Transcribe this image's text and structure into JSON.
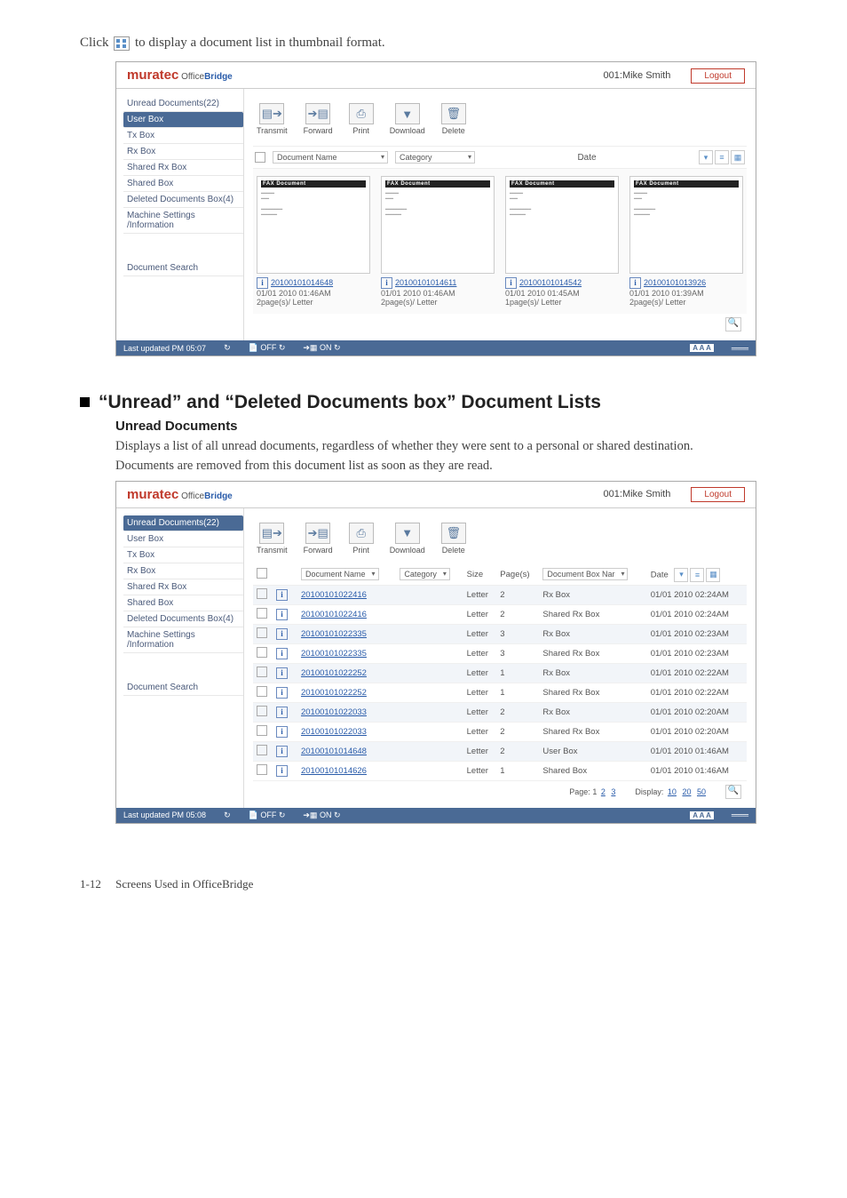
{
  "intro": {
    "prefix": "Click ",
    "suffix": " to display a document list in thumbnail format."
  },
  "brand": {
    "name": "muratec",
    "sub1": "Office",
    "sub2": "Bridge"
  },
  "user": "001:Mike Smith",
  "logout": "Logout",
  "sidebar1": {
    "items": [
      "Unread Documents(22)",
      "User Box",
      "Tx Box",
      "Rx Box",
      "Shared Rx Box",
      "Shared Box",
      "Deleted Documents Box(4)",
      "Machine Settings /Information"
    ],
    "bottom": "Document Search",
    "selected": 1
  },
  "toolbar": {
    "items": [
      {
        "label": "Transmit",
        "glyph": "▤➔"
      },
      {
        "label": "Forward",
        "glyph": "➔▤"
      },
      {
        "label": "Print",
        "glyph": "⎙"
      },
      {
        "label": "Download",
        "glyph": "▼"
      },
      {
        "label": "Delete",
        "glyph": "🗑"
      }
    ]
  },
  "filterBar1": {
    "docName": "Document Name",
    "category": "Category",
    "date": "Date"
  },
  "thumbs": [
    {
      "id": "20100101014648",
      "date": "01/01 2010 01:46AM",
      "pages": "2page(s)/ Letter"
    },
    {
      "id": "20100101014611",
      "date": "01/01 2010 01:46AM",
      "pages": "2page(s)/ Letter"
    },
    {
      "id": "20100101014542",
      "date": "01/01 2010 01:45AM",
      "pages": "1page(s)/ Letter"
    },
    {
      "id": "20100101013926",
      "date": "01/01 2010 01:39AM",
      "pages": "2page(s)/ Letter"
    }
  ],
  "faxHeader": "FAX Document",
  "footer": {
    "updated": "Last updated PM 05:07",
    "updated2": "Last updated PM 05:08",
    "off": "OFF",
    "on": "ON",
    "aaa": "A A A"
  },
  "heading": "“Unread” and “Deleted Documents box” Document Lists",
  "subheading": "Unread Documents",
  "para1": "Displays a list of all unread documents, regardless of whether they were sent to a personal or shared destination.",
  "para2": "Documents are removed from this document list as soon as they are read.",
  "sidebar2": {
    "items": [
      "Unread Documents(22)",
      "User Box",
      "Tx Box",
      "Rx Box",
      "Shared Rx Box",
      "Shared Box",
      "Deleted Documents Box(4)",
      "Machine Settings /Information"
    ],
    "bottom": "Document Search",
    "selected": 0
  },
  "tableHeaders": {
    "docName": "Document Name",
    "category": "Category",
    "size": "Size",
    "pages": "Page(s)",
    "box": "Document Box Nar",
    "date": "Date"
  },
  "rows": [
    {
      "id": "20100101022416",
      "size": "Letter",
      "pages": "2",
      "box": "Rx Box",
      "date": "01/01 2010 02:24AM"
    },
    {
      "id": "20100101022416",
      "size": "Letter",
      "pages": "2",
      "box": "Shared Rx Box",
      "date": "01/01 2010 02:24AM"
    },
    {
      "id": "20100101022335",
      "size": "Letter",
      "pages": "3",
      "box": "Rx Box",
      "date": "01/01 2010 02:23AM"
    },
    {
      "id": "20100101022335",
      "size": "Letter",
      "pages": "3",
      "box": "Shared Rx Box",
      "date": "01/01 2010 02:23AM"
    },
    {
      "id": "20100101022252",
      "size": "Letter",
      "pages": "1",
      "box": "Rx Box",
      "date": "01/01 2010 02:22AM"
    },
    {
      "id": "20100101022252",
      "size": "Letter",
      "pages": "1",
      "box": "Shared Rx Box",
      "date": "01/01 2010 02:22AM"
    },
    {
      "id": "20100101022033",
      "size": "Letter",
      "pages": "2",
      "box": "Rx Box",
      "date": "01/01 2010 02:20AM"
    },
    {
      "id": "20100101022033",
      "size": "Letter",
      "pages": "2",
      "box": "Shared Rx Box",
      "date": "01/01 2010 02:20AM"
    },
    {
      "id": "20100101014648",
      "size": "Letter",
      "pages": "2",
      "box": "User Box",
      "date": "01/01 2010 01:46AM"
    },
    {
      "id": "20100101014626",
      "size": "Letter",
      "pages": "1",
      "box": "Shared Box",
      "date": "01/01 2010 01:46AM"
    }
  ],
  "pager": {
    "pageLabel": "Page:",
    "pages": [
      "1",
      "2",
      "3"
    ],
    "displayLabel": "Display:",
    "displayOpts": [
      "10",
      "20",
      "50"
    ]
  },
  "pageFooter": {
    "num": "1-12",
    "title": "Screens Used in OfficeBridge"
  }
}
